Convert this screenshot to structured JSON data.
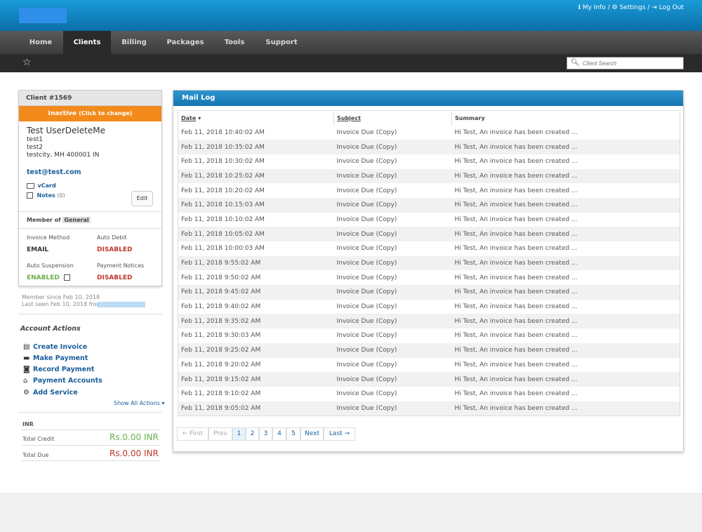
{
  "top_links": {
    "my_info": "My Info",
    "sep1": "/",
    "settings": "Settings",
    "sep2": "/",
    "logout": "Log Out"
  },
  "nav": [
    "Home",
    "Clients",
    "Billing",
    "Packages",
    "Tools",
    "Support"
  ],
  "search": {
    "placeholder": "Client Search"
  },
  "client": {
    "header": "Client #1569",
    "status": "Inactive",
    "status_hint": "(Click to change)",
    "name": "Test UserDeleteMe",
    "address1": "test1",
    "address2": "test2",
    "address3": "testcity, MH 400001 IN",
    "email": "test@test.com",
    "vcard": "vCard",
    "notes_label": "Notes",
    "notes_count": "(0)",
    "edit": "Edit",
    "member_of": "Member of",
    "group": "General",
    "invoice_method_label": "Invoice Method",
    "invoice_method": "EMAIL",
    "auto_debit_label": "Auto Debit",
    "auto_debit": "DISABLED",
    "auto_suspension_label": "Auto Suspension",
    "auto_suspension": "ENABLED",
    "payment_notices_label": "Payment Notices",
    "payment_notices": "DISABLED",
    "member_since": "Member since Feb 10, 2018",
    "last_seen": "Last seen Feb 10, 2018 from"
  },
  "actions": {
    "title": "Account Actions",
    "items": [
      "Create Invoice",
      "Make Payment",
      "Record Payment",
      "Payment Accounts",
      "Add Service"
    ],
    "show_all": "Show All Actions"
  },
  "balance": {
    "currency": "INR",
    "total_credit_label": "Total Credit",
    "total_credit": "Rs.0.00 INR",
    "total_due_label": "Total Due",
    "total_due": "Rs.0.00 INR"
  },
  "mail_log": {
    "title": "Mail Log",
    "columns": [
      "Date",
      "Subject",
      "Summary"
    ],
    "rows": [
      [
        "Feb 11, 2018 10:40:02 AM",
        "Invoice Due (Copy)",
        "Hi Test, An invoice has been created ..."
      ],
      [
        "Feb 11, 2018 10:35:02 AM",
        "Invoice Due (Copy)",
        "Hi Test, An invoice has been created ..."
      ],
      [
        "Feb 11, 2018 10:30:02 AM",
        "Invoice Due (Copy)",
        "Hi Test, An invoice has been created ..."
      ],
      [
        "Feb 11, 2018 10:25:02 AM",
        "Invoice Due (Copy)",
        "Hi Test, An invoice has been created ..."
      ],
      [
        "Feb 11, 2018 10:20:02 AM",
        "Invoice Due (Copy)",
        "Hi Test, An invoice has been created ..."
      ],
      [
        "Feb 11, 2018 10:15:03 AM",
        "Invoice Due (Copy)",
        "Hi Test, An invoice has been created ..."
      ],
      [
        "Feb 11, 2018 10:10:02 AM",
        "Invoice Due (Copy)",
        "Hi Test, An invoice has been created ..."
      ],
      [
        "Feb 11, 2018 10:05:02 AM",
        "Invoice Due (Copy)",
        "Hi Test, An invoice has been created ..."
      ],
      [
        "Feb 11, 2018 10:00:03 AM",
        "Invoice Due (Copy)",
        "Hi Test, An invoice has been created ..."
      ],
      [
        "Feb 11, 2018 9:55:02 AM",
        "Invoice Due (Copy)",
        "Hi Test, An invoice has been created ..."
      ],
      [
        "Feb 11, 2018 9:50:02 AM",
        "Invoice Due (Copy)",
        "Hi Test, An invoice has been created ..."
      ],
      [
        "Feb 11, 2018 9:45:02 AM",
        "Invoice Due (Copy)",
        "Hi Test, An invoice has been created ..."
      ],
      [
        "Feb 11, 2018 9:40:02 AM",
        "Invoice Due (Copy)",
        "Hi Test, An invoice has been created ..."
      ],
      [
        "Feb 11, 2018 9:35:02 AM",
        "Invoice Due (Copy)",
        "Hi Test, An invoice has been created ..."
      ],
      [
        "Feb 11, 2018 9:30:03 AM",
        "Invoice Due (Copy)",
        "Hi Test, An invoice has been created ..."
      ],
      [
        "Feb 11, 2018 9:25:02 AM",
        "Invoice Due (Copy)",
        "Hi Test, An invoice has been created ..."
      ],
      [
        "Feb 11, 2018 9:20:02 AM",
        "Invoice Due (Copy)",
        "Hi Test, An invoice has been created ..."
      ],
      [
        "Feb 11, 2018 9:15:02 AM",
        "Invoice Due (Copy)",
        "Hi Test, An invoice has been created ..."
      ],
      [
        "Feb 11, 2018 9:10:02 AM",
        "Invoice Due (Copy)",
        "Hi Test, An invoice has been created ..."
      ],
      [
        "Feb 11, 2018 9:05:02 AM",
        "Invoice Due (Copy)",
        "Hi Test, An invoice has been created ..."
      ]
    ]
  },
  "pagination": {
    "first": "← First",
    "prev": "Prev",
    "pages": [
      "1",
      "2",
      "3",
      "4",
      "5"
    ],
    "next": "Next",
    "last": "Last →"
  },
  "colors": {
    "header_blue": "#1a9bd8",
    "status_orange": "#f28a1c",
    "enabled_green": "#6ab04c",
    "disabled_red": "#c0392b",
    "link_blue": "#1a5e9c"
  }
}
